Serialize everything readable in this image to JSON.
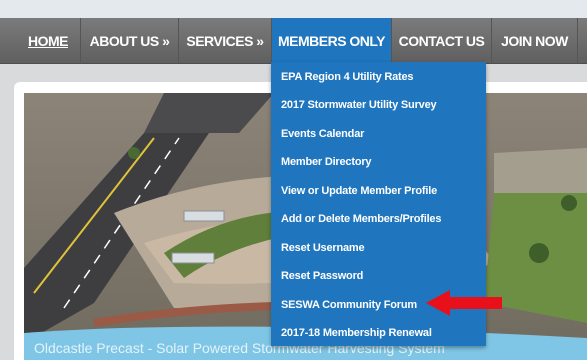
{
  "nav": {
    "items": [
      {
        "label": "HOME"
      },
      {
        "label": "ABOUT US »"
      },
      {
        "label": "SERVICES »"
      },
      {
        "label": "MEMBERS ONLY"
      },
      {
        "label": "CONTACT US"
      },
      {
        "label": "JOIN NOW"
      }
    ],
    "active_index": 3
  },
  "dropdown": {
    "items": [
      {
        "label": "EPA Region 4 Utility Rates"
      },
      {
        "label": "2017 Stormwater Utility Survey"
      },
      {
        "label": "Events Calendar"
      },
      {
        "label": "Member Directory"
      },
      {
        "label": "View or Update Member Profile"
      },
      {
        "label": "Add or Delete Members/Profiles"
      },
      {
        "label": "Reset Username"
      },
      {
        "label": "Reset Password"
      },
      {
        "label": "SESWA Community Forum"
      },
      {
        "label": "2017-18 Membership Renewal"
      }
    ],
    "highlighted_index": 8
  },
  "hero": {
    "caption": "Oldcastle Precast - Solar Powered Stormwater Harvesting System"
  },
  "colors": {
    "nav_bg": "#6d6d6d",
    "active_bg": "#1f75be",
    "dropdown_bg": "#1f75be",
    "arrow": "#e8101a"
  }
}
